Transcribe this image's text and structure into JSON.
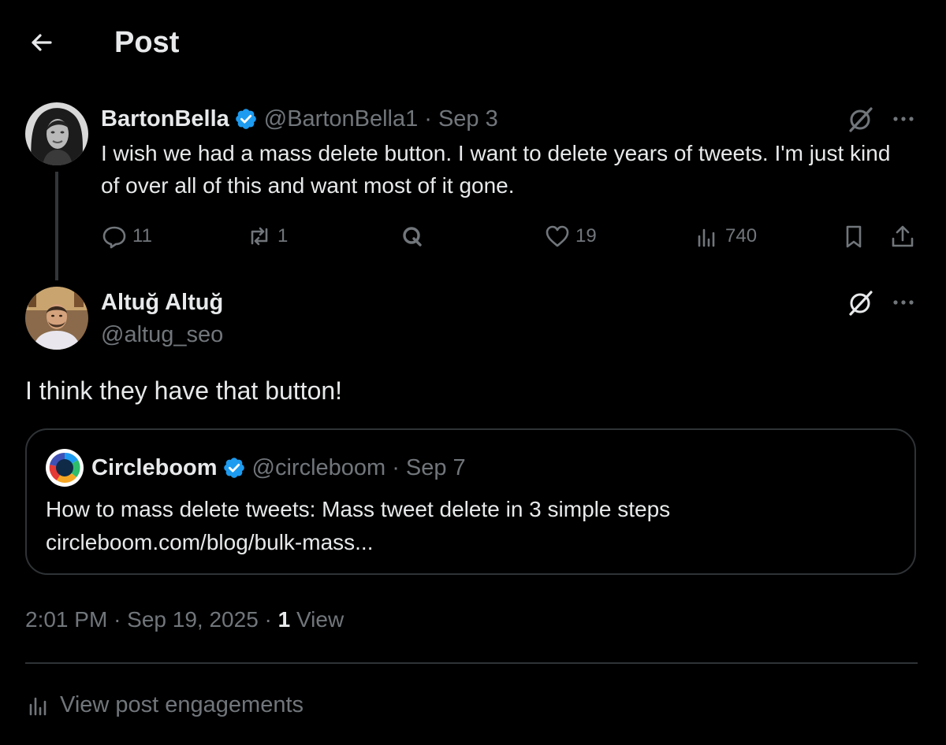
{
  "header": {
    "title": "Post",
    "back_icon": "arrow-left-icon"
  },
  "parent_tweet": {
    "display_name": "BartonBella",
    "verified": true,
    "handle": "@BartonBella1",
    "separator": "·",
    "time": "Sep 3",
    "text": "I wish we had a mass delete button.  I want to delete years of tweets. I'm just kind of over all of this and want most of it gone.",
    "actions": {
      "replies": "11",
      "reposts": "1",
      "likes": "19",
      "views": "740"
    }
  },
  "reply_tweet": {
    "display_name": "Altuğ Altuğ",
    "handle": "@altug_seo",
    "text": "I think they have that button!"
  },
  "quoted_tweet": {
    "display_name": "Circleboom",
    "verified": true,
    "handle": "@circleboom",
    "separator": "·",
    "time": "Sep 7",
    "text_line1": "How to mass delete tweets: Mass tweet delete in 3 simple steps",
    "text_line2": "circleboom.com/blog/bulk-mass..."
  },
  "meta": {
    "time": "2:01 PM",
    "separator": "·",
    "date": "Sep 19, 2025",
    "views_count": "1",
    "views_label": "View"
  },
  "engagements_label": "View post engagements",
  "colors": {
    "background": "#000000",
    "primary_text": "#e7e9ea",
    "secondary_text": "#71767b",
    "border": "#2f3336",
    "verified_badge": "#1d9bf0"
  }
}
